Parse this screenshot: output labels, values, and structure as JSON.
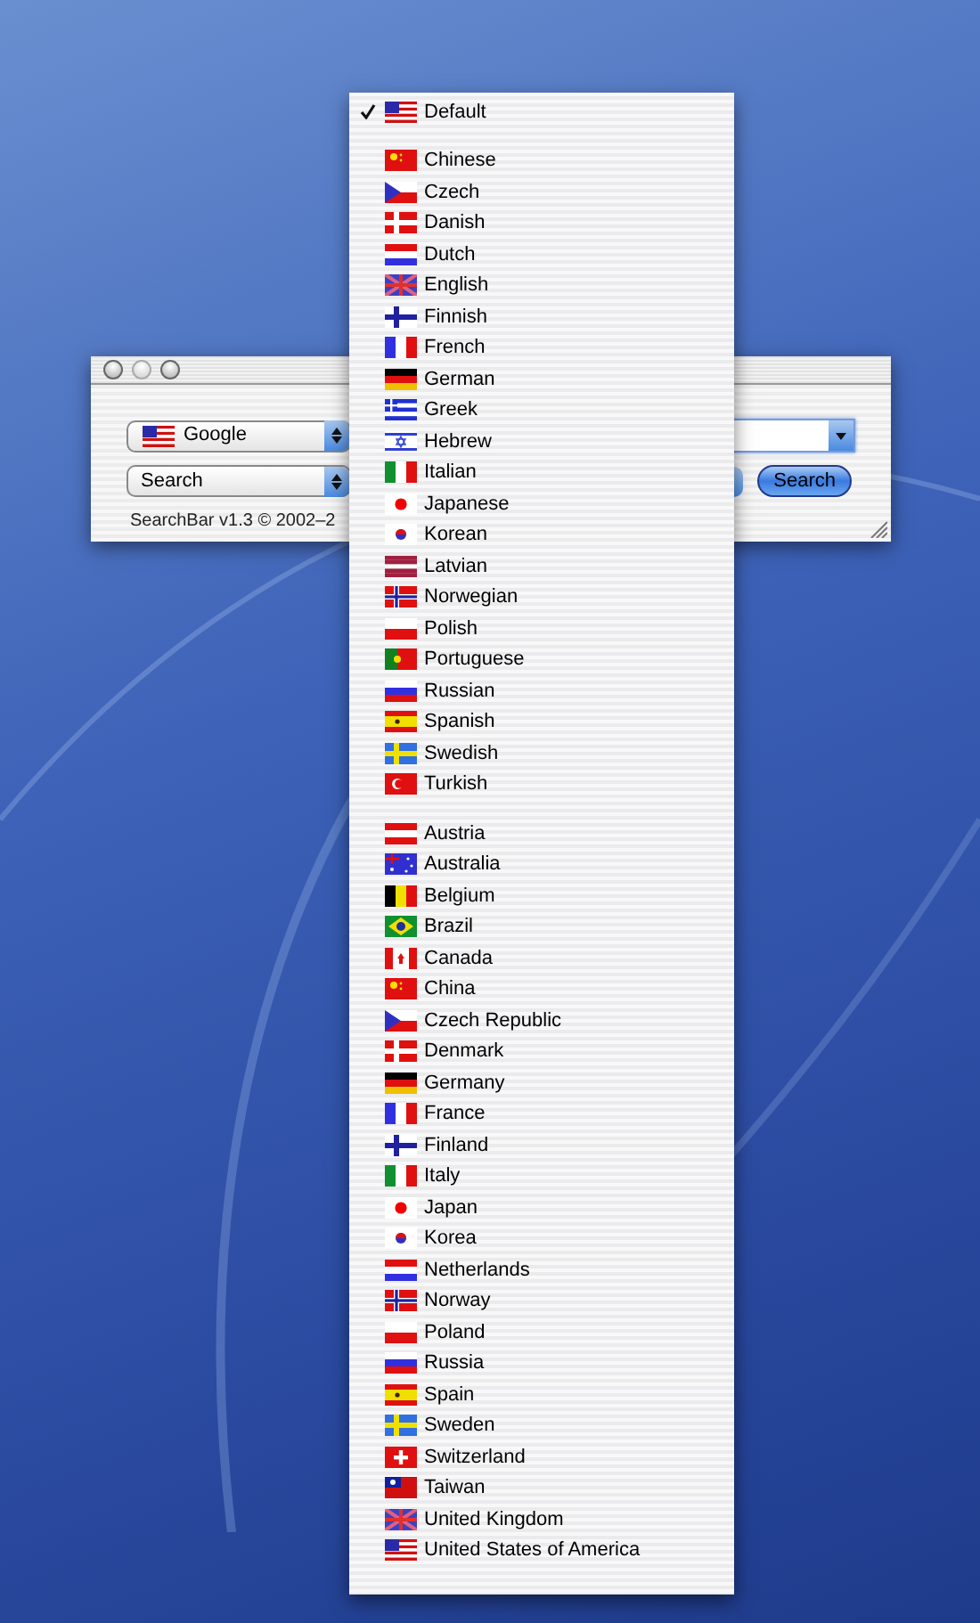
{
  "window": {
    "engine_popup": {
      "label": "Google",
      "flag": {
        "kind": "us"
      }
    },
    "mode_popup": {
      "label": "Search"
    },
    "search_button": {
      "label": "Search"
    },
    "footer": "SearchBar v1.3 © 2002–2"
  },
  "menu": {
    "items": [
      {
        "kind": "item",
        "label": "Default",
        "flag": {
          "kind": "us"
        },
        "checked": true
      },
      {
        "kind": "separator"
      },
      {
        "kind": "item",
        "label": "Chinese",
        "flag": {
          "kind": "cn"
        },
        "checked": false
      },
      {
        "kind": "item",
        "label": "Czech",
        "flag": {
          "kind": "cz"
        },
        "checked": false
      },
      {
        "kind": "item",
        "label": "Danish",
        "flag": {
          "kind": "dk"
        },
        "checked": false
      },
      {
        "kind": "item",
        "label": "Dutch",
        "flag": {
          "kind": "nl"
        },
        "checked": false
      },
      {
        "kind": "item",
        "label": "English",
        "flag": {
          "kind": "gb"
        },
        "checked": false
      },
      {
        "kind": "item",
        "label": "Finnish",
        "flag": {
          "kind": "fi"
        },
        "checked": false
      },
      {
        "kind": "item",
        "label": "French",
        "flag": {
          "kind": "fr"
        },
        "checked": false
      },
      {
        "kind": "item",
        "label": "German",
        "flag": {
          "kind": "de"
        },
        "checked": false
      },
      {
        "kind": "item",
        "label": "Greek",
        "flag": {
          "kind": "gr"
        },
        "checked": false
      },
      {
        "kind": "item",
        "label": "Hebrew",
        "flag": {
          "kind": "il"
        },
        "checked": false
      },
      {
        "kind": "item",
        "label": "Italian",
        "flag": {
          "kind": "it"
        },
        "checked": false
      },
      {
        "kind": "item",
        "label": "Japanese",
        "flag": {
          "kind": "jp"
        },
        "checked": false
      },
      {
        "kind": "item",
        "label": "Korean",
        "flag": {
          "kind": "kr"
        },
        "checked": false
      },
      {
        "kind": "item",
        "label": "Latvian",
        "flag": {
          "kind": "lv"
        },
        "checked": false
      },
      {
        "kind": "item",
        "label": "Norwegian",
        "flag": {
          "kind": "no"
        },
        "checked": false
      },
      {
        "kind": "item",
        "label": "Polish",
        "flag": {
          "kind": "pl"
        },
        "checked": false
      },
      {
        "kind": "item",
        "label": "Portuguese",
        "flag": {
          "kind": "pt"
        },
        "checked": false
      },
      {
        "kind": "item",
        "label": "Russian",
        "flag": {
          "kind": "ru"
        },
        "checked": false
      },
      {
        "kind": "item",
        "label": "Spanish",
        "flag": {
          "kind": "es"
        },
        "checked": false
      },
      {
        "kind": "item",
        "label": "Swedish",
        "flag": {
          "kind": "se"
        },
        "checked": false
      },
      {
        "kind": "item",
        "label": "Turkish",
        "flag": {
          "kind": "tr"
        },
        "checked": false
      },
      {
        "kind": "separator"
      },
      {
        "kind": "item",
        "label": "Austria",
        "flag": {
          "kind": "at"
        },
        "checked": false
      },
      {
        "kind": "item",
        "label": "Australia",
        "flag": {
          "kind": "au"
        },
        "checked": false
      },
      {
        "kind": "item",
        "label": "Belgium",
        "flag": {
          "kind": "be"
        },
        "checked": false
      },
      {
        "kind": "item",
        "label": "Brazil",
        "flag": {
          "kind": "br"
        },
        "checked": false
      },
      {
        "kind": "item",
        "label": "Canada",
        "flag": {
          "kind": "ca"
        },
        "checked": false
      },
      {
        "kind": "item",
        "label": "China",
        "flag": {
          "kind": "cn"
        },
        "checked": false
      },
      {
        "kind": "item",
        "label": "Czech Republic",
        "flag": {
          "kind": "cz"
        },
        "checked": false
      },
      {
        "kind": "item",
        "label": "Denmark",
        "flag": {
          "kind": "dk"
        },
        "checked": false
      },
      {
        "kind": "item",
        "label": "Germany",
        "flag": {
          "kind": "de"
        },
        "checked": false
      },
      {
        "kind": "item",
        "label": "France",
        "flag": {
          "kind": "fr"
        },
        "checked": false
      },
      {
        "kind": "item",
        "label": "Finland",
        "flag": {
          "kind": "fi"
        },
        "checked": false
      },
      {
        "kind": "item",
        "label": "Italy",
        "flag": {
          "kind": "it"
        },
        "checked": false
      },
      {
        "kind": "item",
        "label": "Japan",
        "flag": {
          "kind": "jp"
        },
        "checked": false
      },
      {
        "kind": "item",
        "label": "Korea",
        "flag": {
          "kind": "kr"
        },
        "checked": false
      },
      {
        "kind": "item",
        "label": "Netherlands",
        "flag": {
          "kind": "nl"
        },
        "checked": false
      },
      {
        "kind": "item",
        "label": "Norway",
        "flag": {
          "kind": "no"
        },
        "checked": false
      },
      {
        "kind": "item",
        "label": "Poland",
        "flag": {
          "kind": "pl"
        },
        "checked": false
      },
      {
        "kind": "item",
        "label": "Russia",
        "flag": {
          "kind": "ru"
        },
        "checked": false
      },
      {
        "kind": "item",
        "label": "Spain",
        "flag": {
          "kind": "es"
        },
        "checked": false
      },
      {
        "kind": "item",
        "label": "Sweden",
        "flag": {
          "kind": "se"
        },
        "checked": false
      },
      {
        "kind": "item",
        "label": "Switzerland",
        "flag": {
          "kind": "ch"
        },
        "checked": false
      },
      {
        "kind": "item",
        "label": "Taiwan",
        "flag": {
          "kind": "tw"
        },
        "checked": false
      },
      {
        "kind": "item",
        "label": "United Kingdom",
        "flag": {
          "kind": "gb"
        },
        "checked": false
      },
      {
        "kind": "item",
        "label": "United States of America",
        "flag": {
          "kind": "us"
        },
        "checked": false
      }
    ]
  }
}
